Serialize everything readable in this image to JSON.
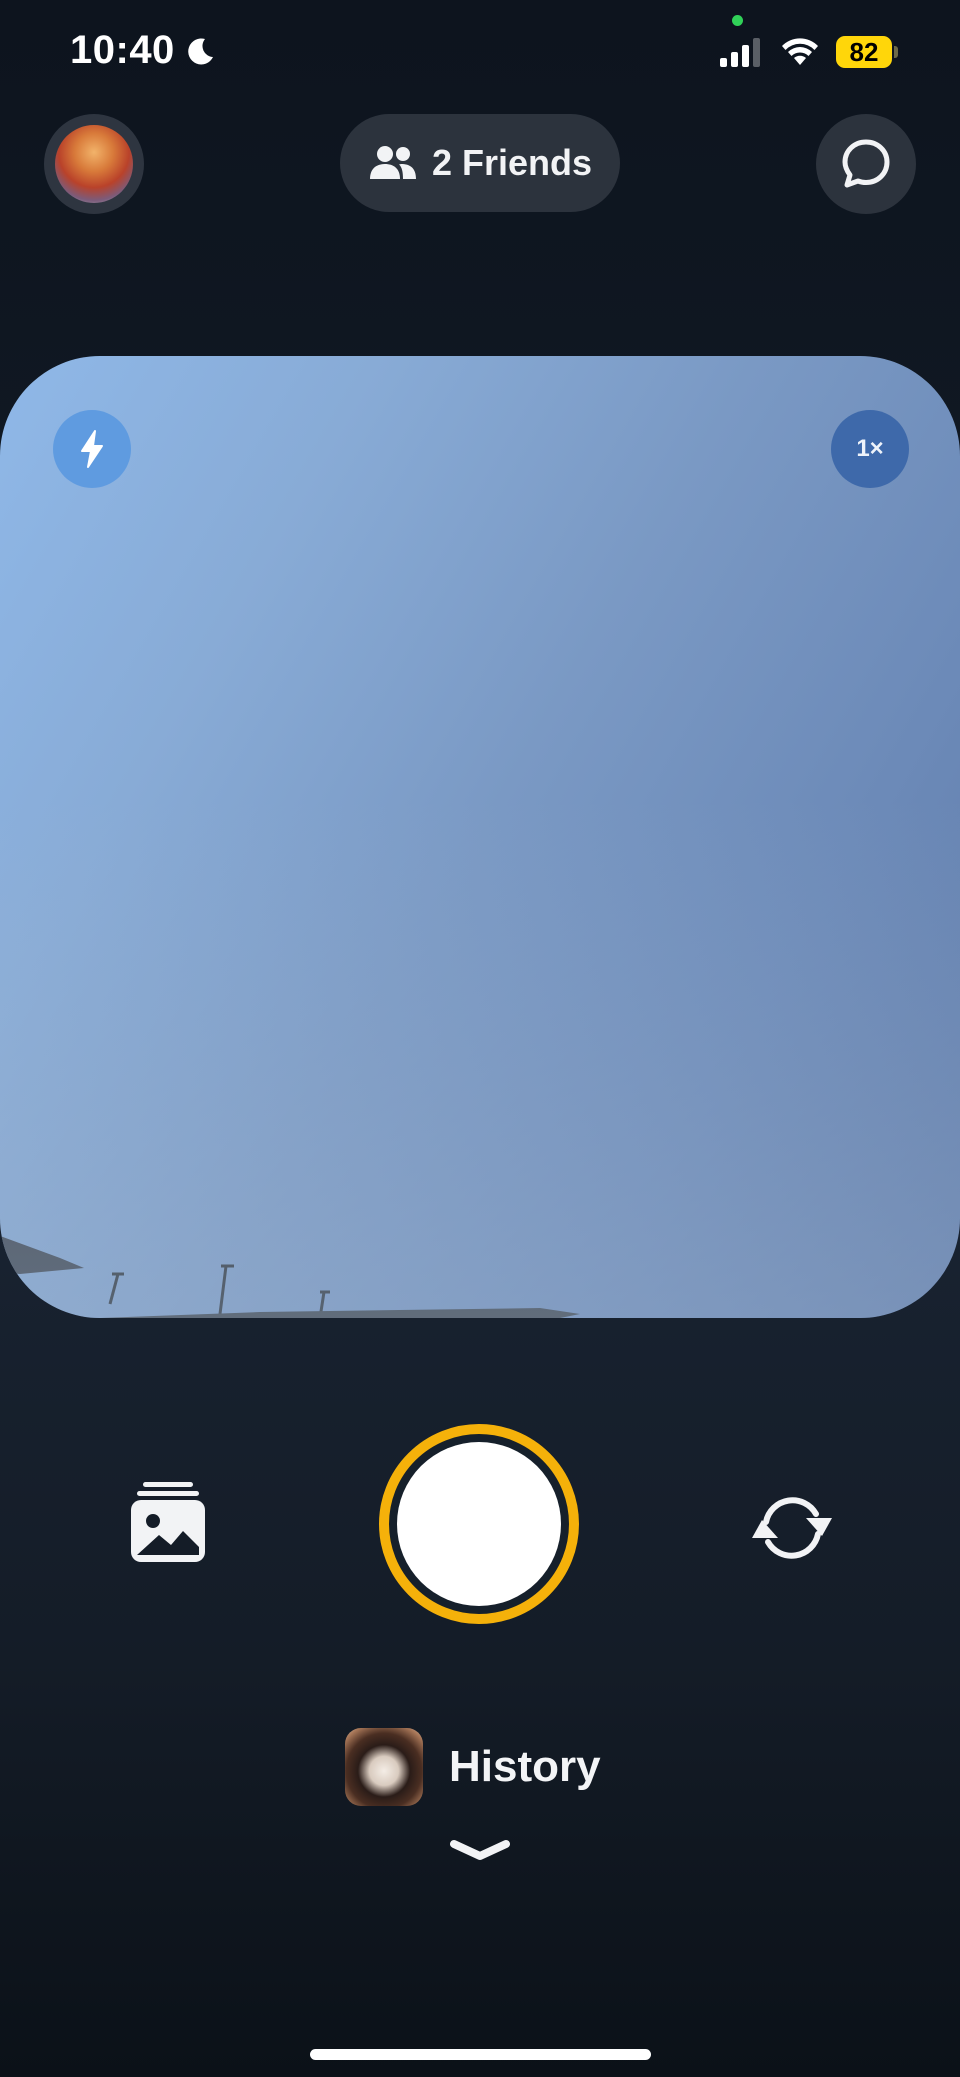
{
  "status_bar": {
    "time": "10:40",
    "battery_level": "82",
    "icons": [
      "moon-icon",
      "cellular-signal-icon",
      "wifi-icon",
      "battery-icon"
    ],
    "battery_color": "#ffd60a",
    "privacy_dot_color": "#30d158"
  },
  "top_bar": {
    "friends_label": "2 Friends",
    "icons": [
      "profile-avatar",
      "friends-icon",
      "chat-bubble-icon"
    ]
  },
  "camera": {
    "zoom_label": "1×",
    "icons": [
      "flash-icon"
    ],
    "accent_flash_bg": "#5f9be0",
    "zoom_bg": "#3e69aa"
  },
  "controls": {
    "icons": [
      "gallery-icon",
      "shutter-button",
      "flip-camera-icon"
    ],
    "shutter_ring_color": "#f5b10a"
  },
  "history": {
    "label": "History",
    "icons": [
      "history-thumbnail",
      "chevron-down-icon"
    ]
  }
}
